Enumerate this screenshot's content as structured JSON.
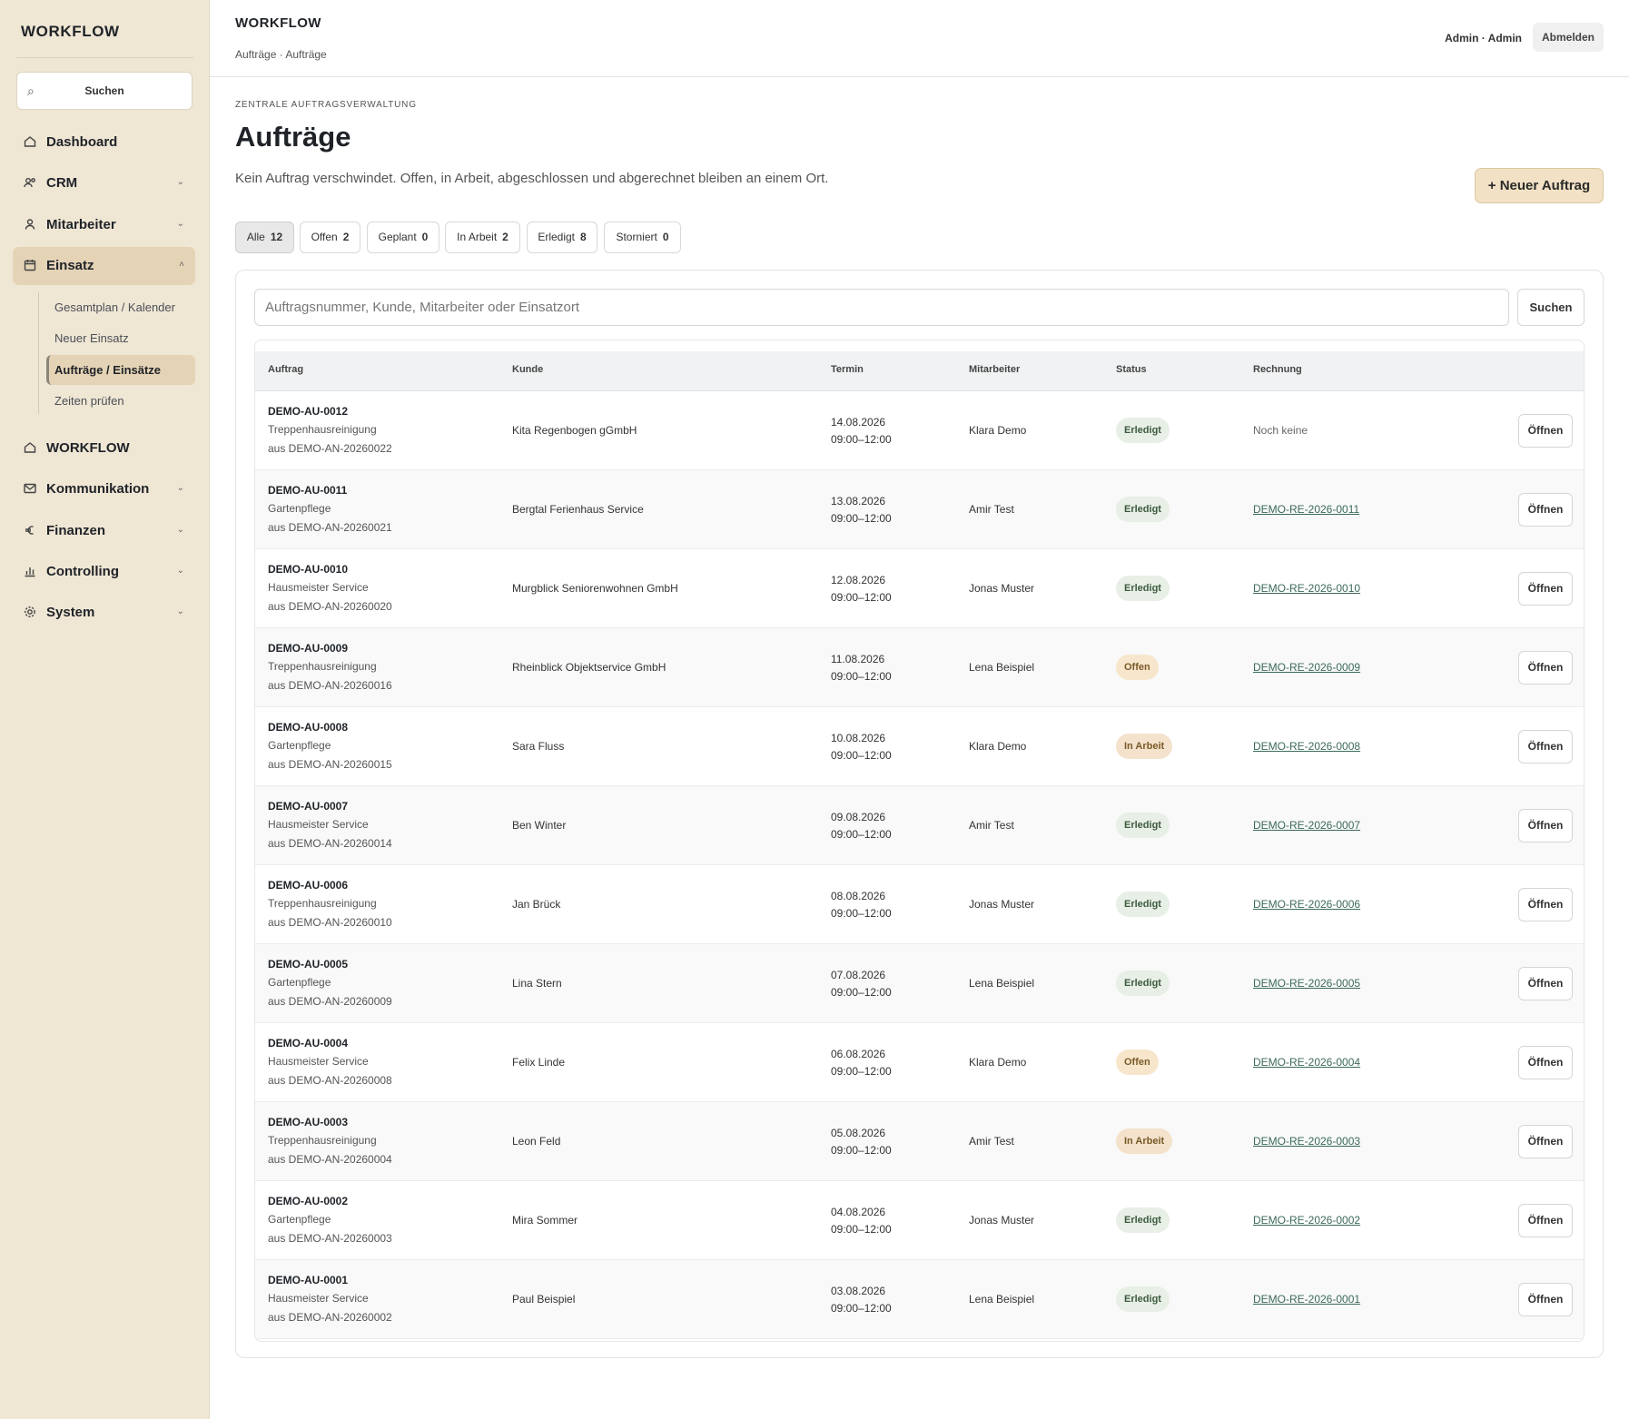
{
  "sidebar": {
    "brand": "WORKFLOW",
    "search_label": "Suchen",
    "nav": [
      {
        "label": "Dashboard",
        "icon": "home-icon",
        "chevron": ""
      },
      {
        "label": "CRM",
        "icon": "users-icon",
        "chevron": "⌄"
      },
      {
        "label": "Mitarbeiter",
        "icon": "user-icon",
        "chevron": "⌄"
      },
      {
        "label": "Einsatz",
        "icon": "calendar-icon",
        "chevron": "˄"
      },
      {
        "label": "WORKFLOW",
        "icon": "home-icon",
        "chevron": ""
      },
      {
        "label": "Kommunikation",
        "icon": "mail-icon",
        "chevron": "⌄"
      },
      {
        "label": "Finanzen",
        "icon": "euro-icon",
        "chevron": "⌄"
      },
      {
        "label": "Controlling",
        "icon": "bar-chart-icon",
        "chevron": "⌄"
      },
      {
        "label": "System",
        "icon": "gear-icon",
        "chevron": "⌄"
      }
    ],
    "sub": [
      "Gesamtplan / Kalender",
      "Neuer Einsatz",
      "Aufträge / Einsätze",
      "Zeiten prüfen"
    ]
  },
  "header": {
    "title": "WORKFLOW",
    "breadcrumb": "Aufträge · Aufträge",
    "user": "Admin · Admin",
    "logout": "Abmelden"
  },
  "main": {
    "eyebrow": "ZENTRALE AUFTRAGSVERWALTUNG",
    "title": "Aufträge",
    "subtitle": "Kein Auftrag verschwindet. Offen, in Arbeit, abgeschlossen und abgerechnet bleiben an einem Ort.",
    "new_button": "+ Neuer Auftrag",
    "filters": [
      {
        "label": "Alle",
        "count": "12"
      },
      {
        "label": "Offen",
        "count": "2"
      },
      {
        "label": "Geplant",
        "count": "0"
      },
      {
        "label": "In Arbeit",
        "count": "2"
      },
      {
        "label": "Erledigt",
        "count": "8"
      },
      {
        "label": "Storniert",
        "count": "0"
      }
    ],
    "search_placeholder": "Auftragsnummer, Kunde, Mitarbeiter oder Einsatzort",
    "search_button": "Suchen"
  },
  "table": {
    "headers": {
      "auftrag": "Auftrag",
      "kunde": "Kunde",
      "termin": "Termin",
      "mitarbeiter": "Mitarbeiter",
      "status": "Status",
      "rechnung": "Rechnung"
    },
    "open_label": "Öffnen",
    "rows": [
      {
        "id": "DEMO-AU-0012",
        "service": "Treppenhausreinigung",
        "source": "aus DEMO-AN-20260022",
        "kunde": "Kita Regenbogen gGmbH",
        "date": "14.08.2026",
        "time": "09:00–12:00",
        "ma": "Klara Demo",
        "status": "Erledigt",
        "invoice": "Noch keine"
      },
      {
        "id": "DEMO-AU-0011",
        "service": "Gartenpflege",
        "source": "aus DEMO-AN-20260021",
        "kunde": "Bergtal Ferienhaus Service",
        "date": "13.08.2026",
        "time": "09:00–12:00",
        "ma": "Amir Test",
        "status": "Erledigt",
        "invoice": "DEMO-RE-2026-0011"
      },
      {
        "id": "DEMO-AU-0010",
        "service": "Hausmeister Service",
        "source": "aus DEMO-AN-20260020",
        "kunde": "Murgblick Seniorenwohnen GmbH",
        "date": "12.08.2026",
        "time": "09:00–12:00",
        "ma": "Jonas Muster",
        "status": "Erledigt",
        "invoice": "DEMO-RE-2026-0010"
      },
      {
        "id": "DEMO-AU-0009",
        "service": "Treppenhausreinigung",
        "source": "aus DEMO-AN-20260016",
        "kunde": "Rheinblick Objektservice GmbH",
        "date": "11.08.2026",
        "time": "09:00–12:00",
        "ma": "Lena Beispiel",
        "status": "Offen",
        "invoice": "DEMO-RE-2026-0009"
      },
      {
        "id": "DEMO-AU-0008",
        "service": "Gartenpflege",
        "source": "aus DEMO-AN-20260015",
        "kunde": "Sara Fluss",
        "date": "10.08.2026",
        "time": "09:00–12:00",
        "ma": "Klara Demo",
        "status": "In Arbeit",
        "invoice": "DEMO-RE-2026-0008"
      },
      {
        "id": "DEMO-AU-0007",
        "service": "Hausmeister Service",
        "source": "aus DEMO-AN-20260014",
        "kunde": "Ben Winter",
        "date": "09.08.2026",
        "time": "09:00–12:00",
        "ma": "Amir Test",
        "status": "Erledigt",
        "invoice": "DEMO-RE-2026-0007"
      },
      {
        "id": "DEMO-AU-0006",
        "service": "Treppenhausreinigung",
        "source": "aus DEMO-AN-20260010",
        "kunde": "Jan Brück",
        "date": "08.08.2026",
        "time": "09:00–12:00",
        "ma": "Jonas Muster",
        "status": "Erledigt",
        "invoice": "DEMO-RE-2026-0006"
      },
      {
        "id": "DEMO-AU-0005",
        "service": "Gartenpflege",
        "source": "aus DEMO-AN-20260009",
        "kunde": "Lina Stern",
        "date": "07.08.2026",
        "time": "09:00–12:00",
        "ma": "Lena Beispiel",
        "status": "Erledigt",
        "invoice": "DEMO-RE-2026-0005"
      },
      {
        "id": "DEMO-AU-0004",
        "service": "Hausmeister Service",
        "source": "aus DEMO-AN-20260008",
        "kunde": "Felix Linde",
        "date": "06.08.2026",
        "time": "09:00–12:00",
        "ma": "Klara Demo",
        "status": "Offen",
        "invoice": "DEMO-RE-2026-0004"
      },
      {
        "id": "DEMO-AU-0003",
        "service": "Treppenhausreinigung",
        "source": "aus DEMO-AN-20260004",
        "kunde": "Leon Feld",
        "date": "05.08.2026",
        "time": "09:00–12:00",
        "ma": "Amir Test",
        "status": "In Arbeit",
        "invoice": "DEMO-RE-2026-0003"
      },
      {
        "id": "DEMO-AU-0002",
        "service": "Gartenpflege",
        "source": "aus DEMO-AN-20260003",
        "kunde": "Mira Sommer",
        "date": "04.08.2026",
        "time": "09:00–12:00",
        "ma": "Jonas Muster",
        "status": "Erledigt",
        "invoice": "DEMO-RE-2026-0002"
      },
      {
        "id": "DEMO-AU-0001",
        "service": "Hausmeister Service",
        "source": "aus DEMO-AN-20260002",
        "kunde": "Paul Beispiel",
        "date": "03.08.2026",
        "time": "09:00–12:00",
        "ma": "Lena Beispiel",
        "status": "Erledigt",
        "invoice": "DEMO-RE-2026-0001"
      }
    ]
  },
  "colors": {
    "sidebar_bg": "#efe6d4",
    "active_bg": "#e5d3b6",
    "accent_button": "#f2e1c4",
    "link": "#3c6a5a"
  }
}
